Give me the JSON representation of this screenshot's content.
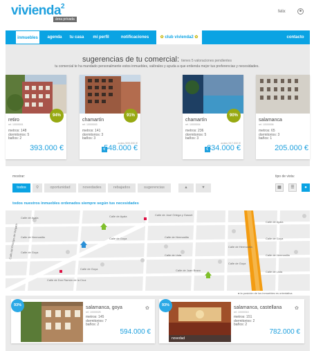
{
  "header": {
    "logo": "vivienda",
    "logo_sup": "2",
    "logo_sub": "área privada",
    "user_name": "felix"
  },
  "nav": {
    "items": [
      "inmuebles",
      "agenda",
      "tu casa",
      "mi perfil",
      "notificaciones"
    ],
    "club": "club vivienda2",
    "contact": "contacto"
  },
  "suggestions": {
    "title": "sugerencias de tu comercial:",
    "pending": "tienes 5 valoraciones pendientes",
    "subtitle": "tu comercial te ha mandado personalmente estos inmuebles, valóralos y ayuda a que entienda mejor tus preferencias y necesidades.",
    "cards": [
      {
        "location": "retiro",
        "ref": "ref. 10000001",
        "specs": [
          "metros: 148",
          "dormitorios: 5",
          "baños: 2"
        ],
        "match": "94%",
        "old_price": "",
        "price": "393.000 €"
      },
      {
        "location": "chamartín",
        "ref": "ref. 10000003",
        "specs": [
          "metros: 141",
          "dormitorios: 3",
          "baños: 3"
        ],
        "match": "91%",
        "old_price": "antes 599.000 €",
        "price": "548.000 €"
      },
      {
        "location": "chamartín",
        "ref": "ref. 10000004",
        "specs": [
          "metros: 236",
          "dormitorios: 5",
          "baños: 3"
        ],
        "match": "90%",
        "old_price": "antes 917.000 €",
        "price": "834.000 €"
      },
      {
        "location": "salamanca",
        "ref": "ref. 10000006",
        "specs": [
          "metros: 65",
          "dormitorios: 3",
          "baños: 1"
        ],
        "match": "",
        "old_price": "",
        "price": "205.000 €"
      }
    ]
  },
  "filters": {
    "label": "mostrar:",
    "buttons": [
      "todos",
      "oportunidad",
      "novedades",
      "rebajados",
      "sugerencias"
    ],
    "view_label": "tipo de vista:",
    "all_text": "todos nuestros inmuebles ordenados siempre según tus necesidades"
  },
  "map": {
    "note": "la posición de los inmuebles es orientativa",
    "streets": [
      "Calle de Ayala",
      "Calle de Ayala",
      "Calle de Hermosilla",
      "Calle de Goya",
      "Calle de Goya",
      "Calle de Hermosilla",
      "Calle de Lista",
      "Calle de José Ortega y Gasset",
      "Calle de Juan Bravo",
      "Calle del Príncipe de Vergara",
      "Calle de Ayala",
      "Calle de Goya",
      "Calle de Hermosilla",
      "Calle de Lista",
      "Calle de Don Ramón de la Cruz",
      "Calle de Goya",
      "Calle de Hermosilla",
      "Calle de Goya"
    ]
  },
  "bottom": {
    "cards": [
      {
        "match": "93%",
        "location": "salamanca, goya",
        "ref": "ref. 10000025",
        "specs": [
          "metros: 145",
          "dormitorios: 7",
          "baños: 2"
        ],
        "price": "594.000 €",
        "badge": ""
      },
      {
        "match": "93%",
        "location": "salamanca, castellana",
        "ref": "ref. 10000315",
        "specs": [
          "metros: 151",
          "dormitorios: 2",
          "baños: 2"
        ],
        "price": "782.000 €",
        "badge": "novedad"
      }
    ]
  }
}
